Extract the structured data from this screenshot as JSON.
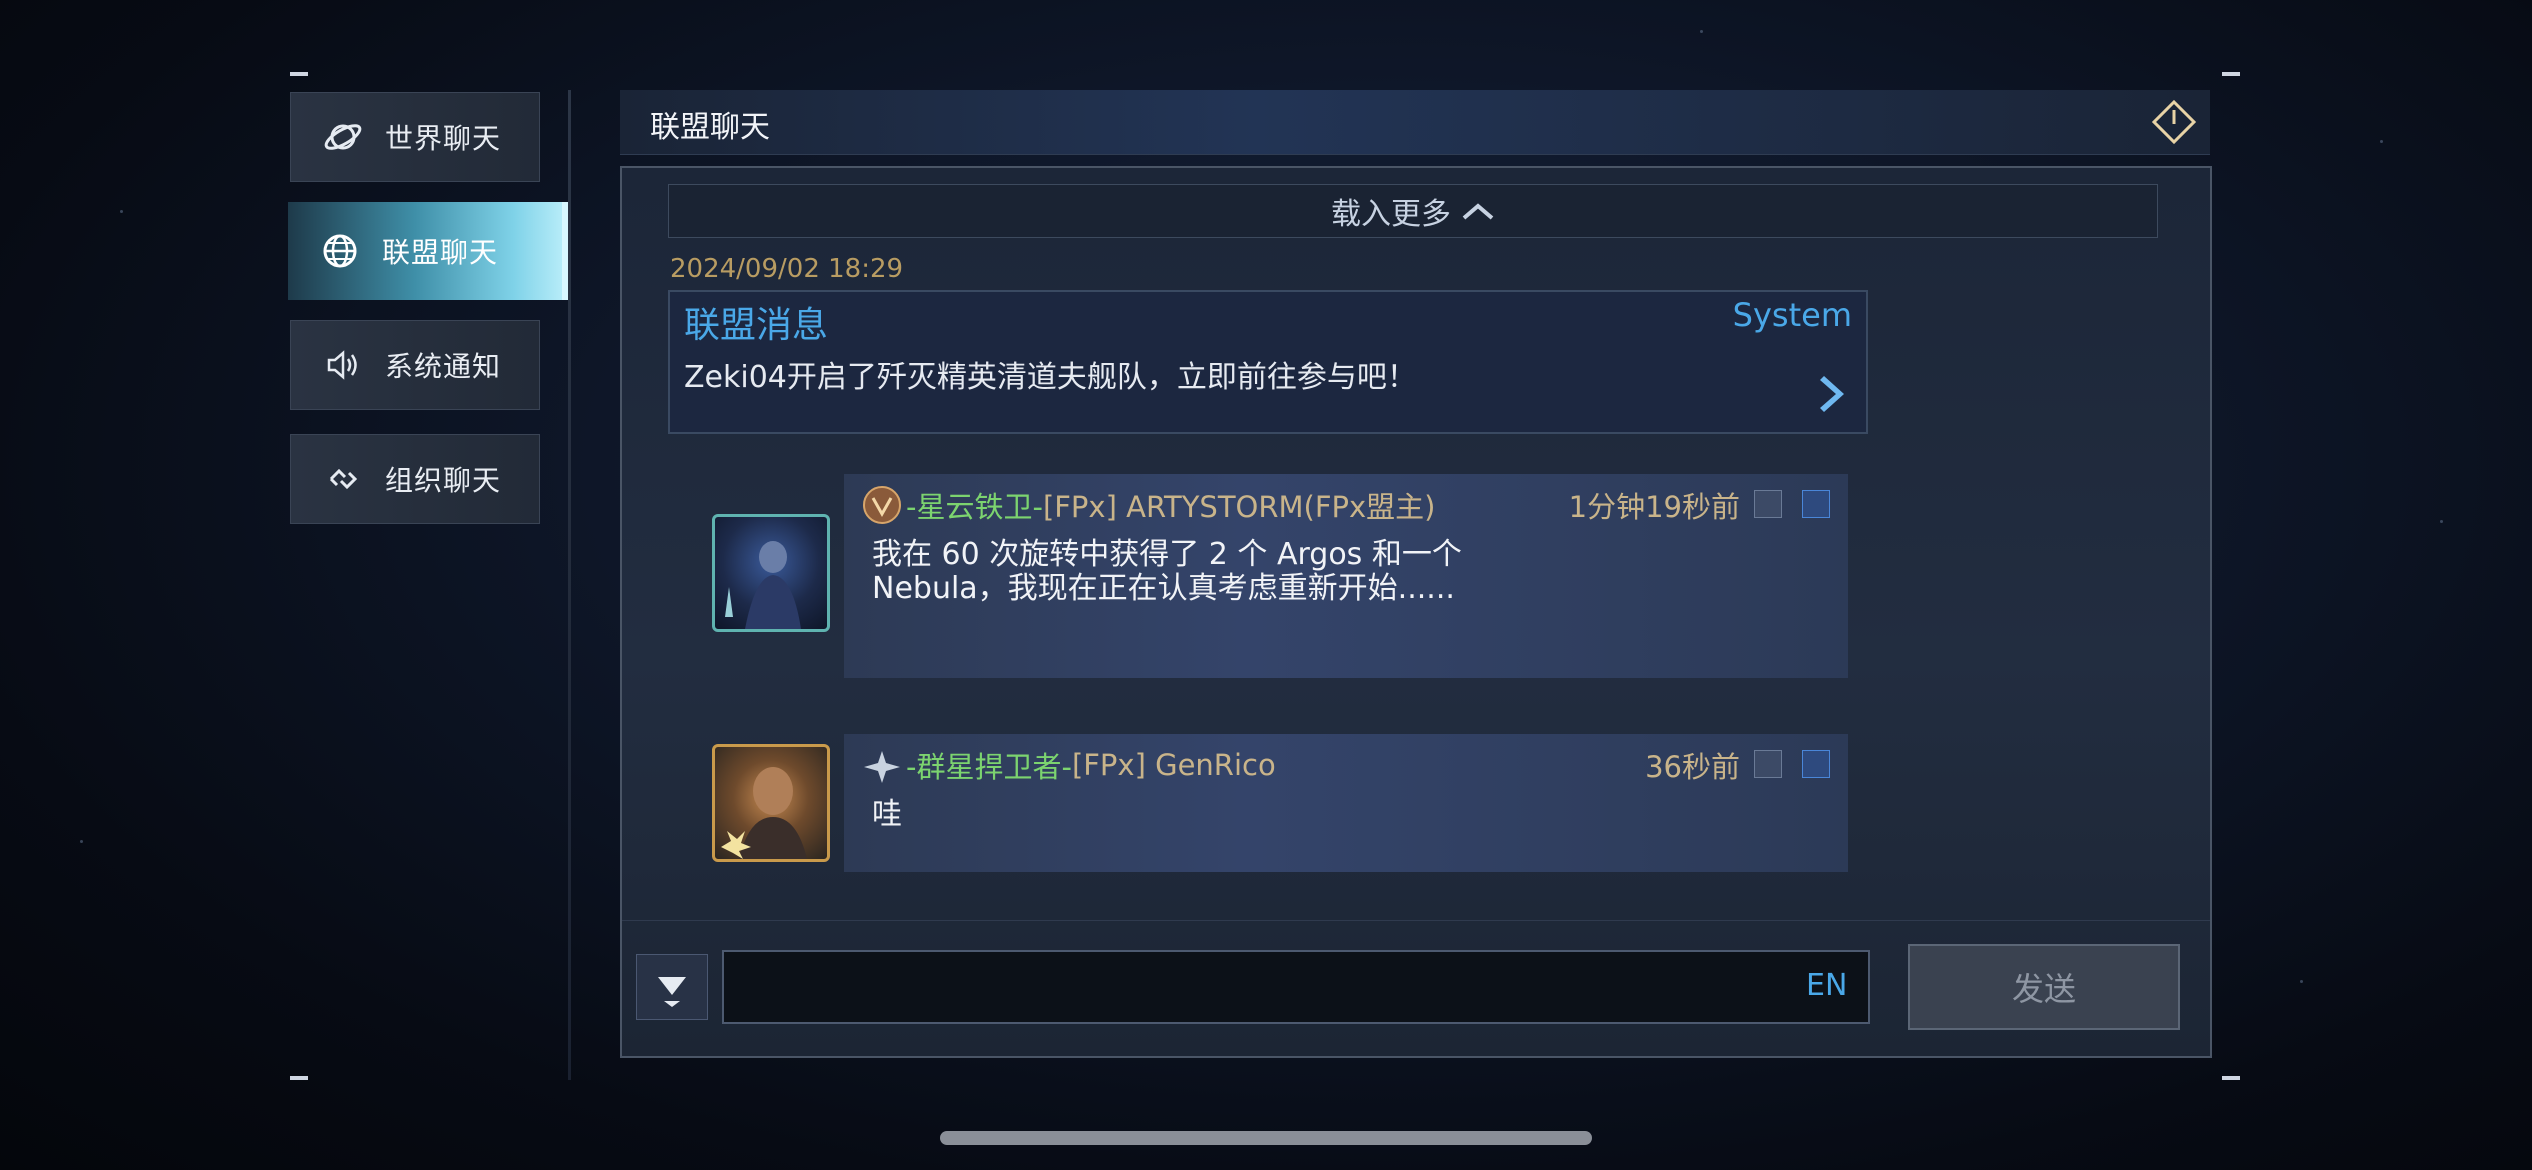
{
  "nav": {
    "items": [
      {
        "label": "世界聊天",
        "icon": "planet-icon",
        "active": false
      },
      {
        "label": "联盟聊天",
        "icon": "globe-icon",
        "active": true
      },
      {
        "label": "系统通知",
        "icon": "speaker-icon",
        "active": false
      },
      {
        "label": "组织聊天",
        "icon": "link-chain-icon",
        "active": false
      }
    ]
  },
  "header": {
    "title": "联盟聊天",
    "exit_icon": "power-exit-icon"
  },
  "chat": {
    "load_more": "载入更多",
    "date": "2024/09/02 18:29",
    "system_message": {
      "title": "联盟消息",
      "source": "System",
      "body": "Zeki04开启了歼灭精英清道夫舰队，立即前往参与吧！"
    },
    "messages": [
      {
        "rank": "-星云铁卫-",
        "name": "[FPx] ARTYSTORM(FPx盟主)",
        "time": "1分钟19秒前",
        "line1": "我在 60 次旋转中获得了 2 个 Argos 和一个",
        "line2": "Nebula，我现在正在认真考虑重新开始......"
      },
      {
        "rank": "-群星捍卫者-",
        "name": "[FPx] GenRico",
        "time": "36秒前",
        "line1": "哇"
      }
    ]
  },
  "input": {
    "value": "",
    "lang": "EN",
    "send_label": "发送"
  },
  "colors": {
    "accent": "#4aa8e8",
    "rank": "#7cd46f",
    "name": "#c9b48a",
    "date": "#b89c62"
  }
}
